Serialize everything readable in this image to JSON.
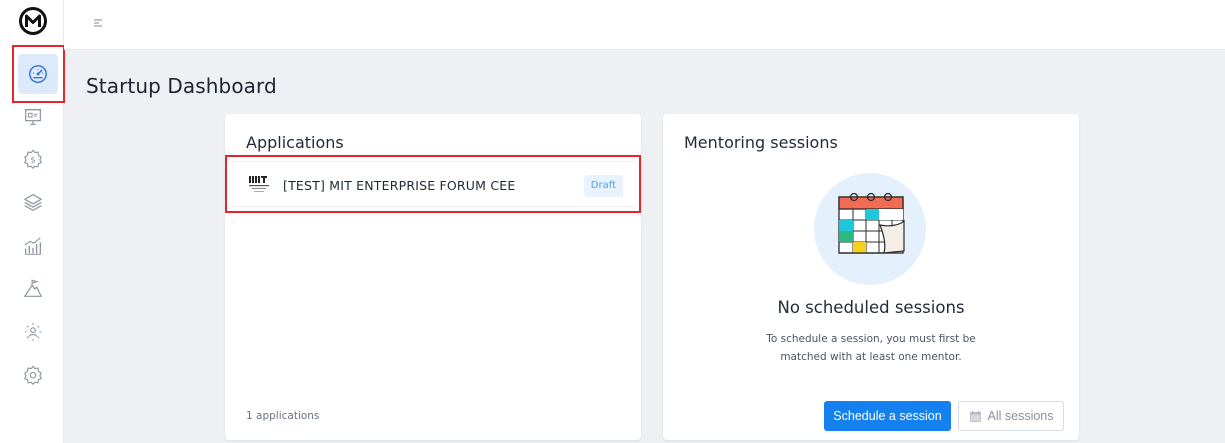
{
  "sidebar": {
    "items": [
      {
        "name": "dashboard",
        "icon": "dashboard-gauge-icon",
        "active": true
      },
      {
        "name": "presentation",
        "icon": "presentation-board-icon"
      },
      {
        "name": "funding",
        "icon": "dollar-gear-icon"
      },
      {
        "name": "layers",
        "icon": "layers-icon"
      },
      {
        "name": "growth",
        "icon": "chart-growth-icon"
      },
      {
        "name": "milestones",
        "icon": "mountain-flag-icon"
      },
      {
        "name": "mentors",
        "icon": "person-network-icon"
      },
      {
        "name": "settings",
        "icon": "gear-icon"
      }
    ]
  },
  "page": {
    "title": "Startup Dashboard"
  },
  "applications": {
    "title": "Applications",
    "items": [
      {
        "name": "[TEST] MIT ENTERPRISE FORUM CEE",
        "status": "Draft"
      }
    ],
    "count_label": "1 applications"
  },
  "mentoring": {
    "title": "Mentoring sessions",
    "empty_title": "No scheduled sessions",
    "empty_text": "To schedule a session, you must first be matched with at least one mentor.",
    "schedule_label": "Schedule a session",
    "all_sessions_label": "All sessions"
  },
  "colors": {
    "primary": "#1581ee",
    "highlight": "#e0262f",
    "badge_bg": "#e8f3fe",
    "badge_text": "#4aa3f0"
  }
}
